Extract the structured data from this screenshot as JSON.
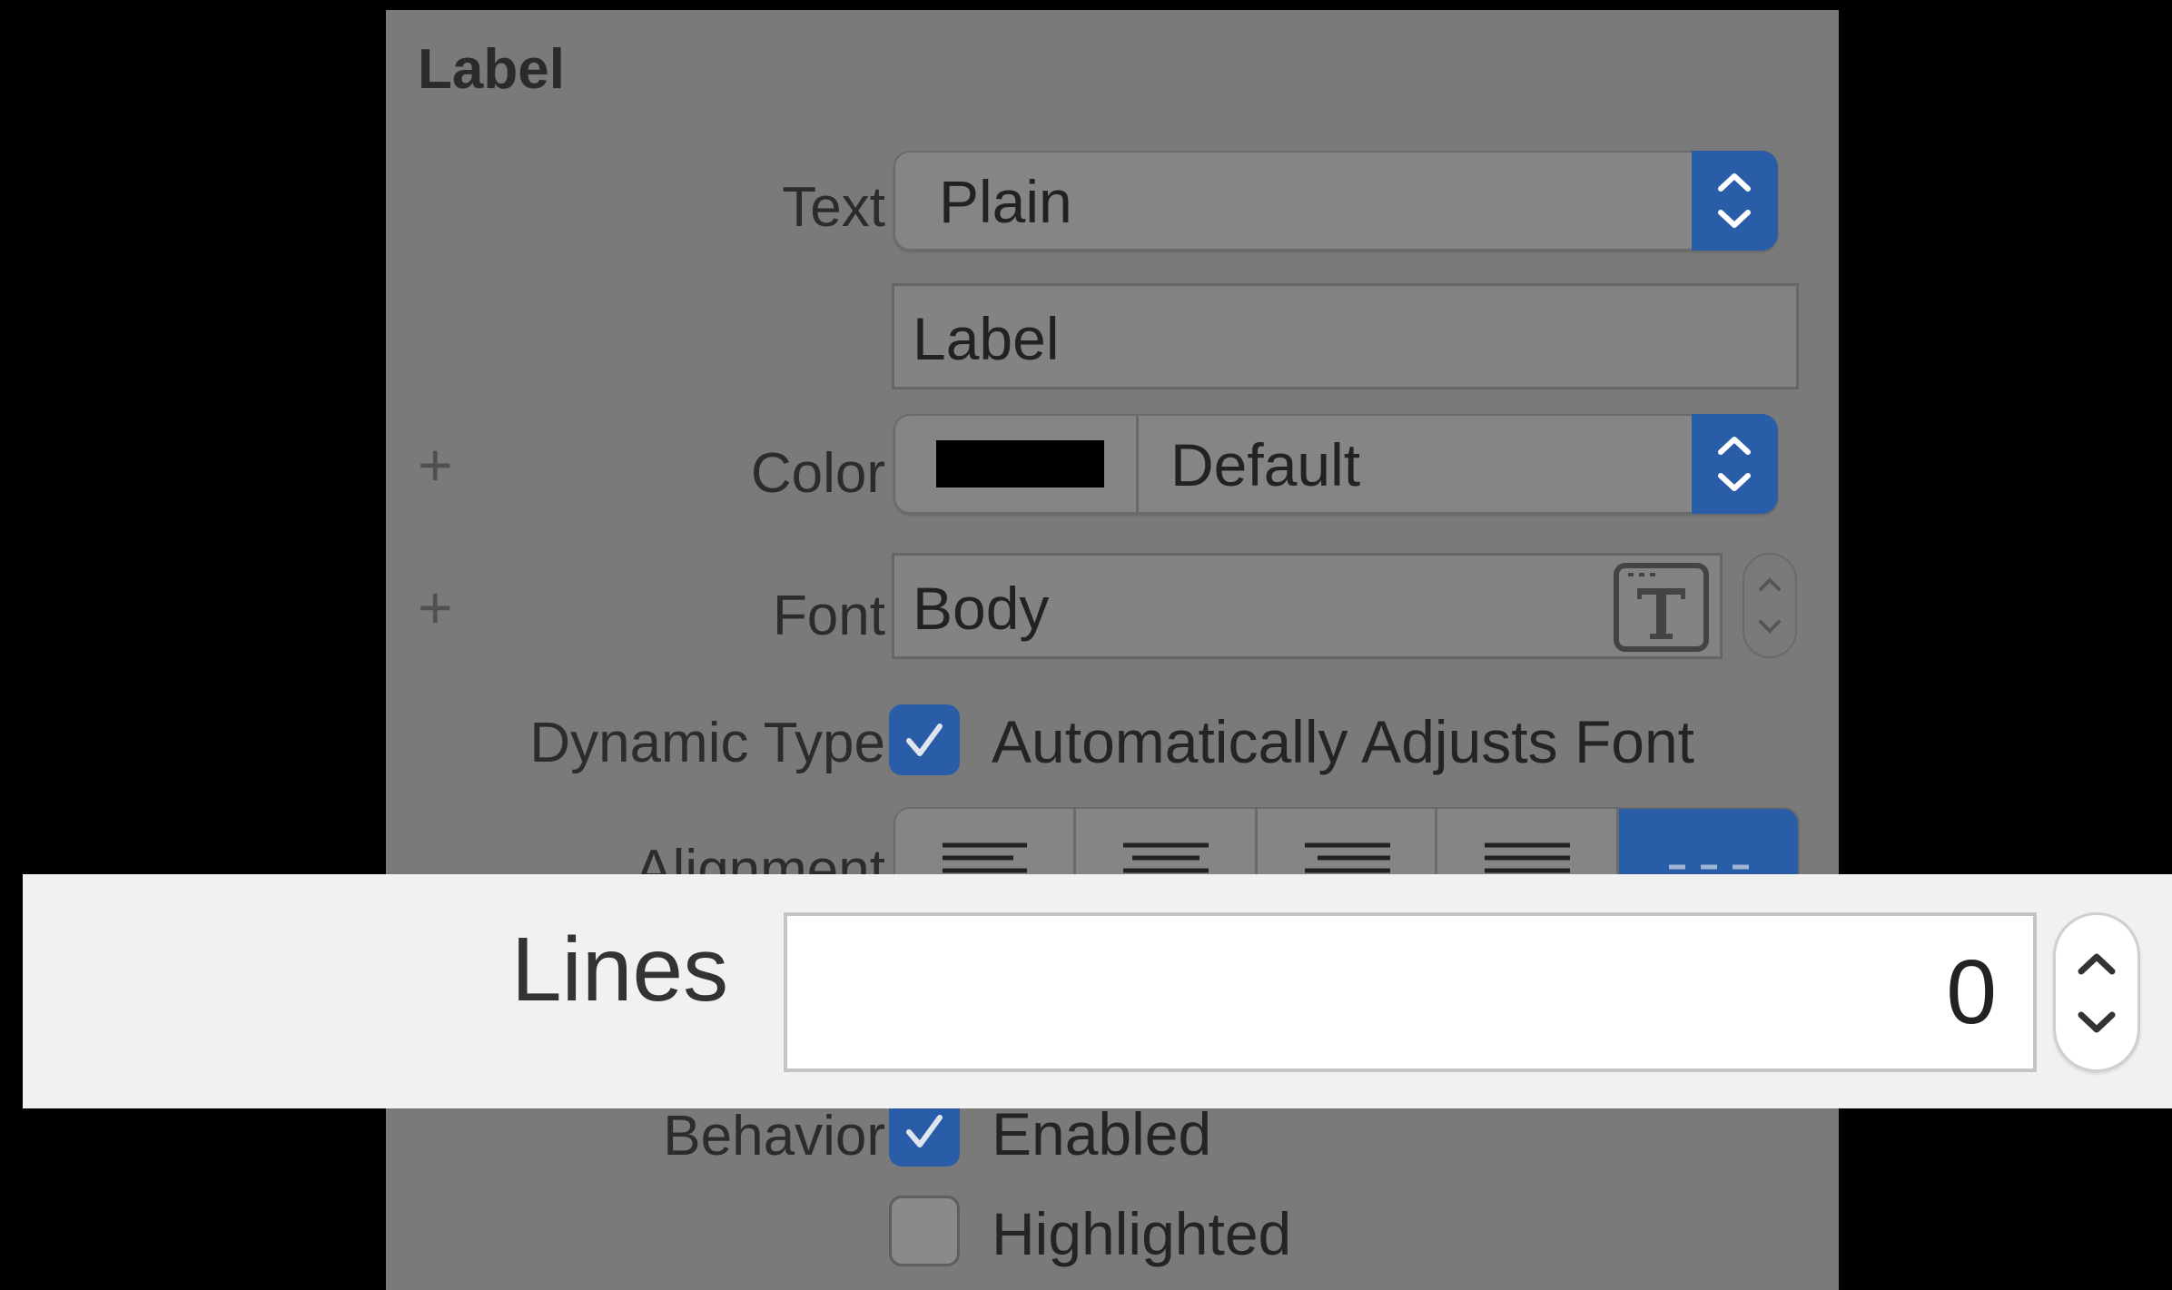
{
  "section": {
    "title": "Label"
  },
  "text_row": {
    "label": "Text",
    "type_value": "Plain",
    "content_value": "Label"
  },
  "color_row": {
    "label": "Color",
    "value": "Default",
    "swatch_color": "#000000"
  },
  "font_row": {
    "label": "Font",
    "value": "Body"
  },
  "dynamic_type_row": {
    "label": "Dynamic Type",
    "checkbox_label": "Automatically Adjusts Font",
    "checked": true
  },
  "alignment_row": {
    "label": "Alignment",
    "options": [
      "left-align-icon",
      "center-align-icon",
      "right-align-icon",
      "justify-align-icon",
      "natural-align-icon"
    ],
    "selected_index": 4
  },
  "lines_row": {
    "label": "Lines",
    "value": "0"
  },
  "behavior_row": {
    "label": "Behavior",
    "enabled_label": "Enabled",
    "enabled_checked": true,
    "highlighted_label": "Highlighted",
    "highlighted_checked": false
  },
  "colors": {
    "accent": "#2a5da7",
    "panel_bg": "#7a7a7a",
    "strip_bg": "#f1f1f1"
  }
}
